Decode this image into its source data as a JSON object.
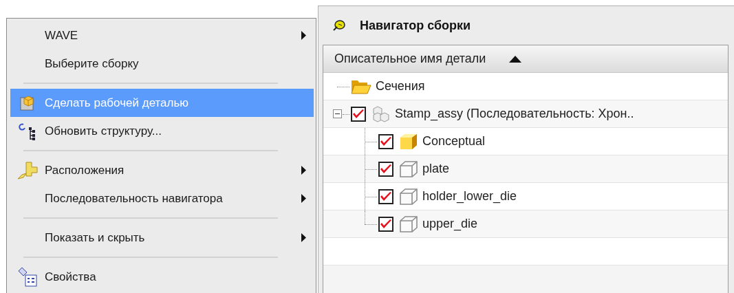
{
  "context_menu": {
    "items": [
      {
        "kind": "item",
        "label": "WAVE",
        "submenu": true,
        "selected": false
      },
      {
        "kind": "item",
        "label": "Выберите сборку",
        "submenu": false,
        "selected": false
      },
      {
        "kind": "separator"
      },
      {
        "kind": "item",
        "label": "Сделать рабочей деталью",
        "submenu": false,
        "selected": true
      },
      {
        "kind": "item",
        "label": "Обновить структуру...",
        "submenu": false,
        "selected": false
      },
      {
        "kind": "separator"
      },
      {
        "kind": "item",
        "label": "Расположения",
        "submenu": true,
        "selected": false
      },
      {
        "kind": "item",
        "label": "Последовательность навигатора",
        "submenu": true,
        "selected": false
      },
      {
        "kind": "separator"
      },
      {
        "kind": "item",
        "label": "Показать и скрыть",
        "submenu": true,
        "selected": false
      },
      {
        "kind": "separator"
      },
      {
        "kind": "item",
        "label": "Свойства",
        "submenu": false,
        "selected": false
      }
    ]
  },
  "navigator": {
    "title": "Навигатор сборки",
    "column": {
      "label": "Описательное имя детали"
    },
    "tree": [
      {
        "kind": "folder",
        "label": "Сечения"
      },
      {
        "kind": "assembly",
        "label": "Stamp_assy (Последовательность: Хрон..",
        "checked": true,
        "expanded": true,
        "children": [
          {
            "kind": "part_active",
            "label": "Conceptual",
            "checked": true
          },
          {
            "kind": "part",
            "label": "plate",
            "checked": true
          },
          {
            "kind": "part",
            "label": "holder_lower_die",
            "checked": true
          },
          {
            "kind": "part",
            "label": "upper_die",
            "checked": true
          }
        ]
      }
    ]
  }
}
